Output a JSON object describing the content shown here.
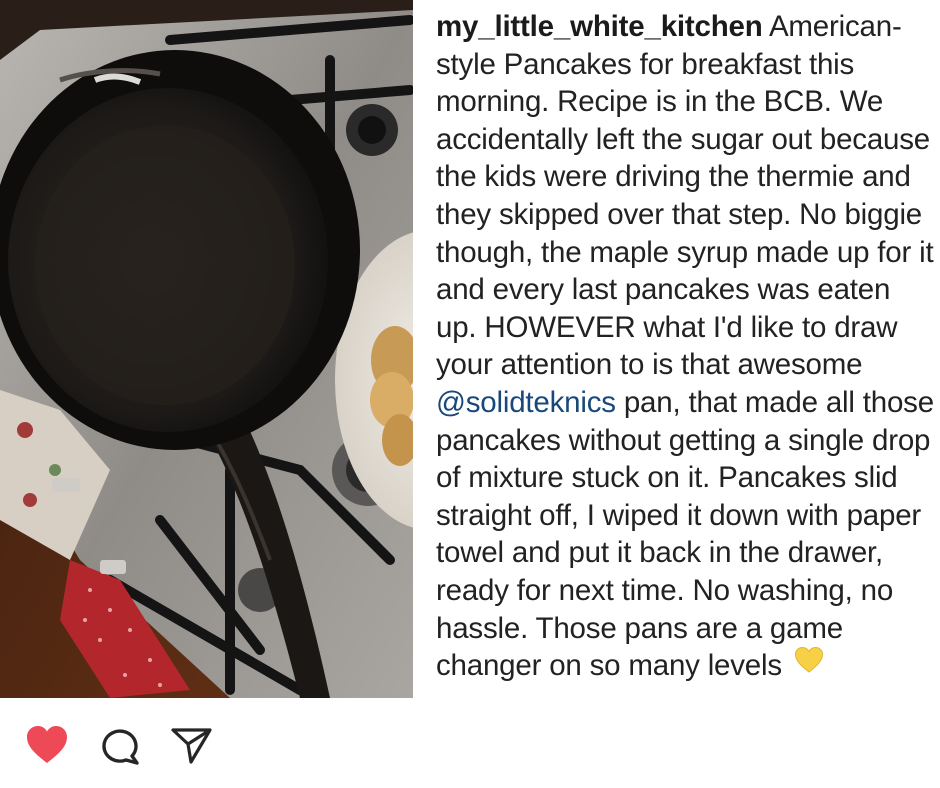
{
  "post": {
    "username": "my_little_white_kitchen",
    "caption_part1": " American-style Pancakes for breakfast this morning. Recipe is in the BCB. We accidentally left the sugar out because the kids were driving the thermie and they skipped over that step. No biggie though, the maple syrup made up for it and every last pancakes was eaten up. HOWEVER what I'd like to draw your attention to is that awesome ",
    "mention": "@solidteknics",
    "caption_part2": " pan, that made all those pancakes without getting a single drop of mixture stuck on it. Pancakes slid straight off, I wiped it down with paper towel and put it back in the drawer, ready for next time. No washing, no hassle. Those pans are a game changer on so many levels ",
    "trailing_emoji": "yellow-heart-icon"
  },
  "actions": {
    "like_icon": "heart-icon",
    "comment_icon": "comment-icon",
    "share_icon": "send-icon"
  },
  "colors": {
    "like_red": "#ed4956",
    "mention_blue": "#19487a",
    "text": "#222222",
    "yellow_heart": "#f7d046"
  }
}
